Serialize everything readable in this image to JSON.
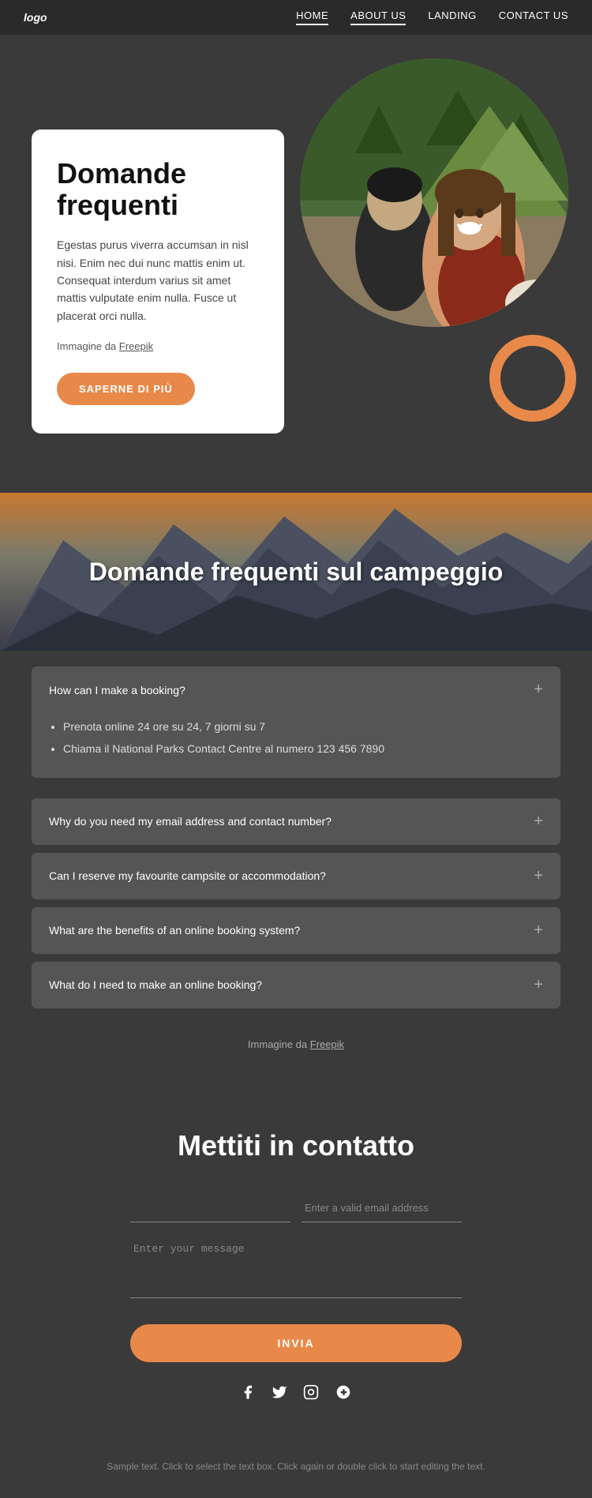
{
  "navbar": {
    "logo": "logo",
    "links": [
      {
        "label": "HOME",
        "active": false
      },
      {
        "label": "ABOUT US",
        "active": true
      },
      {
        "label": "LANDING",
        "active": false
      },
      {
        "label": "CONTACT US",
        "active": false
      }
    ]
  },
  "hero": {
    "title": "Domande frequenti",
    "description": "Egestas purus viverra accumsan in nisl nisi. Enim nec dui nunc mattis enim ut. Consequat interdum varius sit amet mattis vulputate enim nulla. Fusce ut placerat orci nulla.",
    "image_credit": "Immagine da",
    "image_credit_link": "Freepik",
    "button_label": "SAPERNE DI PIÙ"
  },
  "faq_banner": {
    "title": "Domande frequenti sul campeggio"
  },
  "faq": {
    "items": [
      {
        "question": "How can I make a booking?",
        "open": true,
        "answer_bullets": [
          "Prenota online 24 ore su 24, 7 giorni su 7",
          "Chiama il National Parks Contact Centre al numero 123 456 7890"
        ]
      },
      {
        "question": "Why do you need my email address and contact number?",
        "open": false,
        "answer_bullets": []
      },
      {
        "question": "Can I reserve my favourite campsite or accommodation?",
        "open": false,
        "answer_bullets": []
      },
      {
        "question": "What are the benefits of an online booking system?",
        "open": false,
        "answer_bullets": []
      },
      {
        "question": "What do I need to make an online booking?",
        "open": false,
        "answer_bullets": []
      }
    ],
    "image_credit": "Immagine da",
    "image_credit_link": "Freepik"
  },
  "contact": {
    "title": "Mettiti in contatto",
    "name_placeholder": "",
    "email_placeholder": "Enter a valid email address",
    "message_placeholder": "Enter your message",
    "submit_label": "INVIA"
  },
  "social": {
    "icons": [
      "f",
      "t",
      "ig",
      "g+"
    ]
  },
  "footer": {
    "text": "Sample text. Click to select the text box. Click again or double click to start editing the text."
  }
}
